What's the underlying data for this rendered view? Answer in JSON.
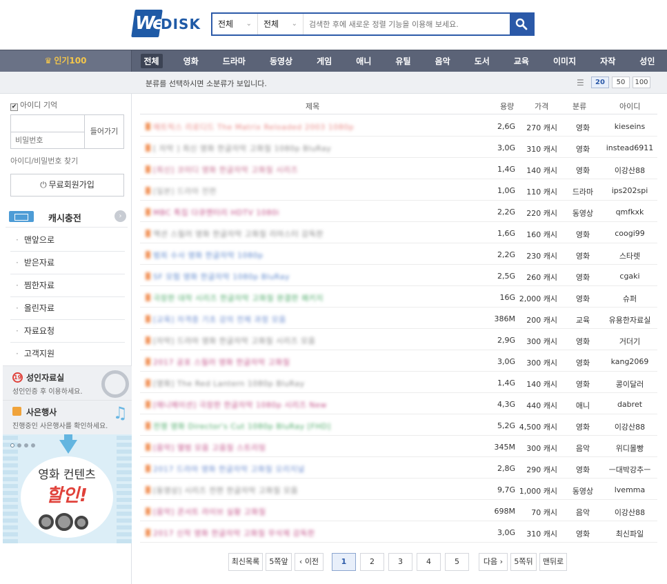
{
  "brand": {
    "logo_w": "We",
    "logo_disk": "DISK"
  },
  "search": {
    "select1": "전체",
    "select2": "전체",
    "placeholder": "검색한 후에 새로운 정렬 기능을 이용해 보세요."
  },
  "nav": {
    "top100": "인기100",
    "items": [
      "전체",
      "영화",
      "드라마",
      "동영상",
      "게임",
      "애니",
      "유틸",
      "음악",
      "도서",
      "교육",
      "이미지",
      "자작",
      "성인"
    ]
  },
  "subbar": {
    "hint": "분류를 선택하시면 소분류가 보입니다.",
    "page_sizes": [
      "20",
      "50",
      "100"
    ]
  },
  "login": {
    "remember": "아이디 기억",
    "pw_placeholder": "비밀번호",
    "login_btn": "들어가기",
    "find": "아이디/비밀번호 찾기",
    "signup": "무료회원가입"
  },
  "sidebar": {
    "cash": "캐시충전",
    "menu": [
      "맨앞으로",
      "받은자료",
      "찜한자료",
      "올린자료",
      "자료요청",
      "고객지원"
    ]
  },
  "adult": {
    "title": "성인자료실",
    "badge": "19",
    "desc": "성인인증 후 이용하세요."
  },
  "event": {
    "title": "사은행사",
    "desc": "진행중인 사은행사를 확인하세요."
  },
  "promo": {
    "line1": "영화 컨텐츠",
    "line2": "할인!"
  },
  "table": {
    "headers": {
      "title": "제목",
      "size": "용량",
      "price": "가격",
      "category": "분류",
      "uploader": "아이디"
    },
    "rows": [
      {
        "title": "매트릭스 리로디드 The Matrix Reloaded 2003 1080p",
        "size": "2,6G",
        "price": "270 캐시",
        "category": "영화",
        "uploader": "kieseins",
        "color": "#e98a86"
      },
      {
        "title": "[ 자막 ] 최신 영화 한글자막 고화질 1080p BluRay",
        "size": "3,0G",
        "price": "310 캐시",
        "category": "영화",
        "uploader": "instead6911",
        "color": "#8d8d8d"
      },
      {
        "title": "[최신] 코미디 영화 한글자막 고화질 시리즈",
        "size": "1,4G",
        "price": "140 캐시",
        "category": "영화",
        "uploader": "이강산88",
        "color": "#c56a8c"
      },
      {
        "title": "[일본] 드라마 전편",
        "size": "1,0G",
        "price": "110 캐시",
        "category": "드라마",
        "uploader": "ips202spi",
        "color": "#9a9a9a"
      },
      {
        "title": "MBC 특집 다큐멘터리 HDTV 1080i",
        "size": "2,2G",
        "price": "220 캐시",
        "category": "동영상",
        "uploader": "qmfkxk",
        "color": "#c4548a"
      },
      {
        "title": "액션 스릴러 영화 한글자막 고화질 리마스터 감독판",
        "size": "1,6G",
        "price": "160 캐시",
        "category": "영화",
        "uploader": "coogi99",
        "color": "#8a8a8a"
      },
      {
        "title": "범죄 수사 영화 한글자막 1080p",
        "size": "2,2G",
        "price": "230 캐시",
        "category": "영화",
        "uploader": "스타렛",
        "color": "#5d87cc"
      },
      {
        "title": "SF 모험 영화 한글자막 1080p BluRay",
        "size": "2,5G",
        "price": "260 캐시",
        "category": "영화",
        "uploader": "cgaki",
        "color": "#5d87cc"
      },
      {
        "title": "극장판 대작 시리즈 한글자막 고화질 완결판 패키지",
        "size": "16G",
        "price": "2,000 캐시",
        "category": "영화",
        "uploader": "슈퍼",
        "color": "#4caa68"
      },
      {
        "title": "[교육] 자격증 기초 강의 전체 과정 모음",
        "size": "386M",
        "price": "200 캐시",
        "category": "교육",
        "uploader": "유용한자료실",
        "color": "#6b8ccf"
      },
      {
        "title": "[자막] 드라마 영화 한글자막 고화질 시리즈 모음",
        "size": "2,9G",
        "price": "300 캐시",
        "category": "영화",
        "uploader": "거더기",
        "color": "#8a8a8a"
      },
      {
        "title": "2017 공포 스릴러 영화 한글자막 고화질",
        "size": "3,0G",
        "price": "300 캐시",
        "category": "영화",
        "uploader": "kang2069",
        "color": "#c4548a"
      },
      {
        "title": "[영화] The Red Lantern 1080p BluRay",
        "size": "1,4G",
        "price": "140 캐시",
        "category": "영화",
        "uploader": "콩이달러",
        "color": "#8a8a8a"
      },
      {
        "title": "[애니메이션] 극장판 한글자막 1080p 시리즈 New",
        "size": "4,3G",
        "price": "440 캐시",
        "category": "애니",
        "uploader": "dabret",
        "color": "#c4548a"
      },
      {
        "title": "전쟁 영화 Director's Cut 1080p BluRay [FHD]",
        "size": "5,2G",
        "price": "4,500 캐시",
        "category": "영화",
        "uploader": "이강산88",
        "color": "#4caa68"
      },
      {
        "title": "[음악] 앨범 모음 고음질 스트리밍",
        "size": "345M",
        "price": "300 캐시",
        "category": "음악",
        "uploader": "위디몰빵",
        "color": "#c4548a"
      },
      {
        "title": "2017 드라마 영화 한글자막 고화질 오리지널",
        "size": "2,8G",
        "price": "290 캐시",
        "category": "영화",
        "uploader": "ㅡ대박강추ㅡ",
        "color": "#6b8ccf"
      },
      {
        "title": "[동영상] 시리즈 전편 한글자막 고화질 모음",
        "size": "9,7G",
        "price": "1,000 캐시",
        "category": "동영상",
        "uploader": "lvemma",
        "color": "#8a8a8a"
      },
      {
        "title": "[음악] 콘서트 라이브 실황 고화질",
        "size": "698M",
        "price": "70 캐시",
        "category": "음악",
        "uploader": "이강산88",
        "color": "#c4548a"
      },
      {
        "title": "2017 신작 영화 한글자막 고화질 무삭제 감독판",
        "size": "3,0G",
        "price": "310 캐시",
        "category": "영화",
        "uploader": "최신파일",
        "color": "#c4548a"
      }
    ]
  },
  "pager": {
    "latest": "최신목록",
    "prev5": "5쪽앞",
    "prev": "‹ 이전",
    "pages": [
      "1",
      "2",
      "3",
      "4",
      "5"
    ],
    "next": "다음 ›",
    "next5": "5쪽뒤",
    "last": "맨뒤로"
  },
  "colors": {
    "accent": "#2b59a8",
    "nav_bg": "#5b6377",
    "top100": "#f3c64b",
    "adult_badge": "#e0413a"
  },
  "icons": [
    "search-icon",
    "crown-icon",
    "list-view-icon",
    "power-icon",
    "battery-icon",
    "chevron-right-icon",
    "film-reel-icon",
    "gift-icon",
    "music-note-icon",
    "down-arrow-icon"
  ]
}
